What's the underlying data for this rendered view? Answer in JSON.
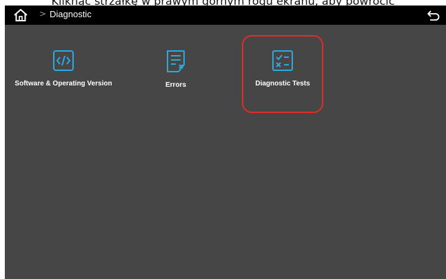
{
  "caption": "Kliknąć strzałkę w prawym górnym rogu ekranu, aby powrócić",
  "header": {
    "separator": ">",
    "breadcrumb": "Diagnostic"
  },
  "tiles": [
    {
      "label": "Software & Operating Version",
      "icon": "code-icon"
    },
    {
      "label": "Errors",
      "icon": "error-list-icon"
    },
    {
      "label": "Diagnostic Tests",
      "icon": "checklist-icon"
    }
  ],
  "colors": {
    "accent": "#2ea8e0",
    "highlight": "#e52a2a",
    "background": "#464646",
    "topbar": "#000000"
  }
}
